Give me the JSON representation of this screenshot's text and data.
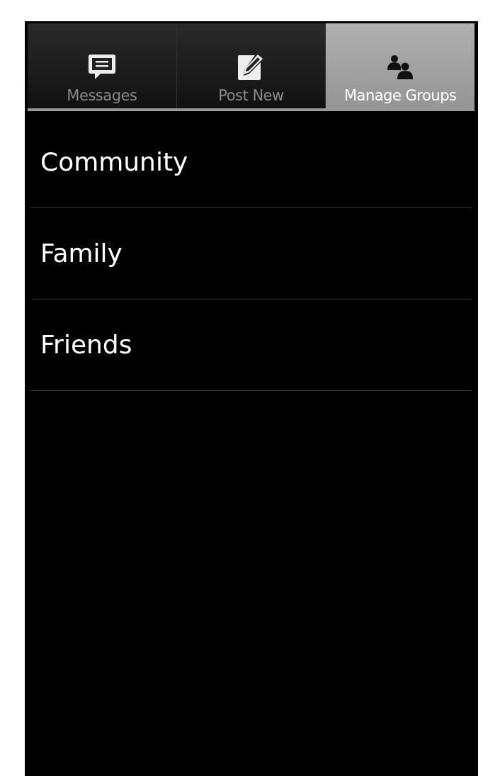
{
  "tabs": [
    {
      "label": "Messages",
      "selected": false
    },
    {
      "label": "Post New",
      "selected": false
    },
    {
      "label": "Manage Groups",
      "selected": true
    }
  ],
  "groups": [
    "Community",
    "Family",
    "Friends"
  ]
}
